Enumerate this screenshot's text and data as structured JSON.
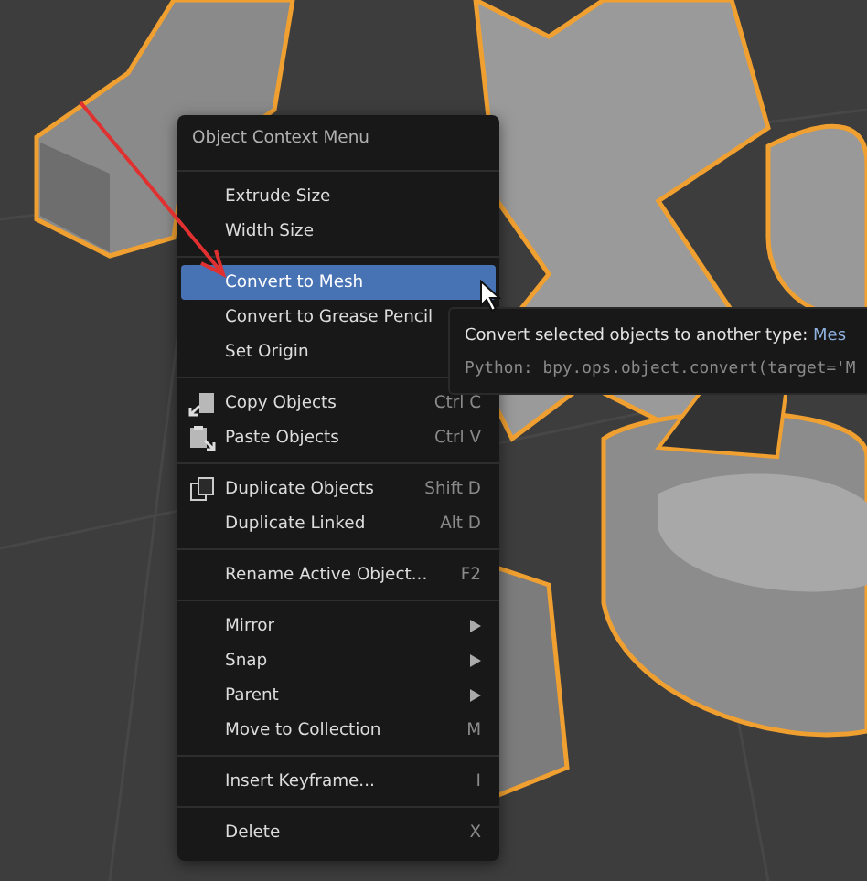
{
  "menu": {
    "title": "Object Context Menu",
    "sections": [
      [
        {
          "label": "Extrude Size",
          "kind": "action",
          "selected": false
        },
        {
          "label": "Width Size",
          "kind": "action",
          "selected": false
        }
      ],
      [
        {
          "label": "Convert to Mesh",
          "kind": "action",
          "selected": true
        },
        {
          "label": "Convert to Grease Pencil",
          "kind": "action",
          "selected": false
        },
        {
          "label": "Set Origin",
          "kind": "action",
          "selected": false
        }
      ],
      [
        {
          "label": "Copy Objects",
          "shortcut": "Ctrl C",
          "kind": "copy",
          "selected": false
        },
        {
          "label": "Paste Objects",
          "shortcut": "Ctrl V",
          "kind": "paste",
          "selected": false
        }
      ],
      [
        {
          "label": "Duplicate Objects",
          "shortcut": "Shift D",
          "kind": "duplicate",
          "selected": false
        },
        {
          "label": "Duplicate Linked",
          "shortcut": "Alt D",
          "kind": "action",
          "selected": false
        }
      ],
      [
        {
          "label": "Rename Active Object...",
          "shortcut": "F2",
          "kind": "action",
          "selected": false
        }
      ],
      [
        {
          "label": "Mirror",
          "kind": "submenu",
          "selected": false
        },
        {
          "label": "Snap",
          "kind": "submenu",
          "selected": false
        },
        {
          "label": "Parent",
          "kind": "submenu",
          "selected": false
        },
        {
          "label": "Move to Collection",
          "shortcut": "M",
          "kind": "action",
          "selected": false
        }
      ],
      [
        {
          "label": "Insert Keyframe...",
          "shortcut": "I",
          "kind": "action",
          "selected": false
        }
      ],
      [
        {
          "label": "Delete",
          "shortcut": "X",
          "kind": "action",
          "selected": false
        }
      ]
    ]
  },
  "tooltip": {
    "description": "Convert selected objects to another type:",
    "value": "Mes",
    "python": "Python: bpy.ops.object.convert(target='M"
  }
}
